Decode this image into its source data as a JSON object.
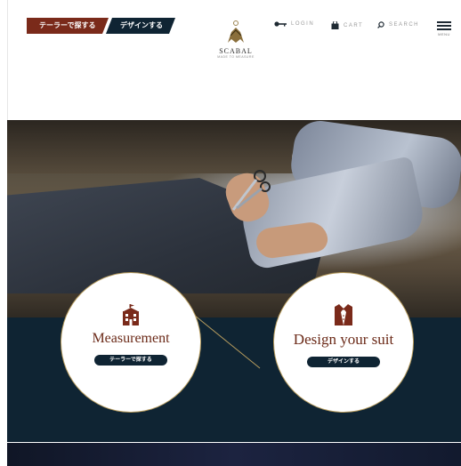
{
  "header": {
    "tabs": [
      {
        "label": "テーラーで探する"
      },
      {
        "label": "デザインする"
      }
    ],
    "logo": {
      "name": "SCABAL",
      "tagline": "MADE TO MEASURE"
    },
    "login_label": "LOGIN",
    "cart_label": "CART",
    "search_label": "SEARCH",
    "menu_label": "MENU"
  },
  "cards": [
    {
      "title": "Measurement",
      "button": "テーラーで探する"
    },
    {
      "title": "Design your suit",
      "button": "デザインする"
    }
  ],
  "colors": {
    "brand_red": "#7a2a1a",
    "navy": "#0f2433",
    "gold": "#b79c5e"
  }
}
